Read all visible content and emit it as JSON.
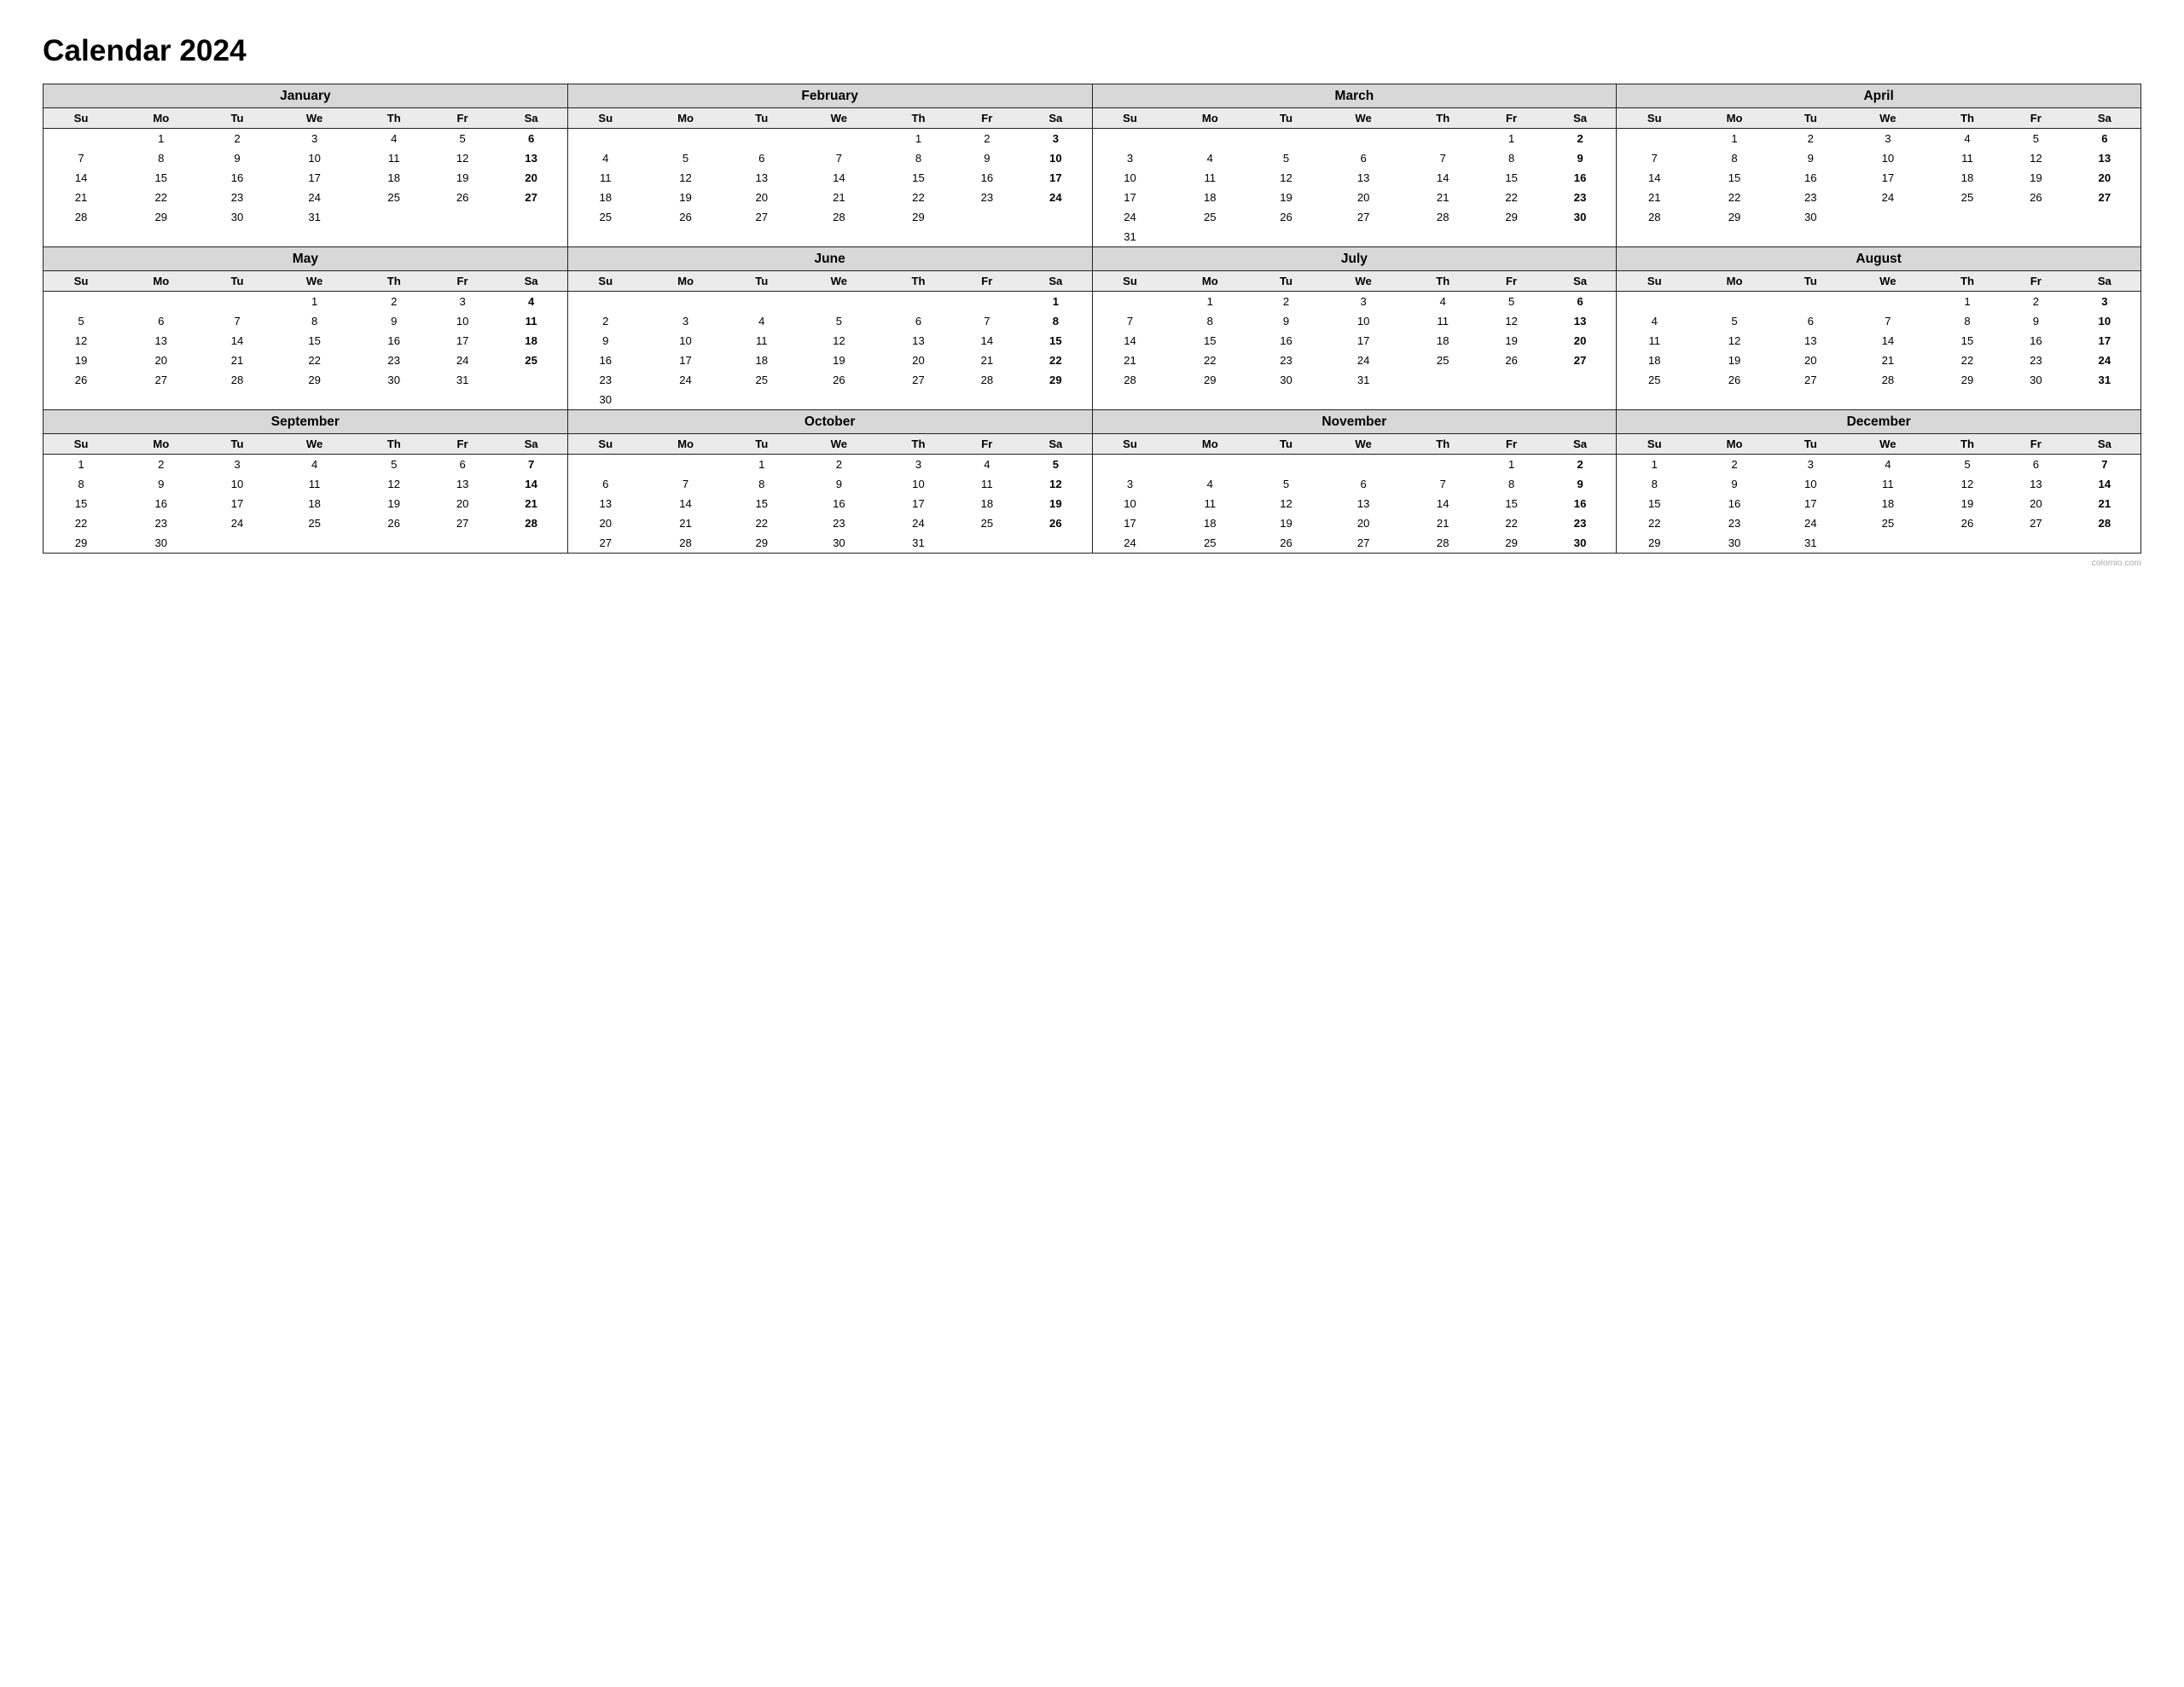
{
  "title": "Calendar 2024",
  "watermark": "colomio.com",
  "days_header": [
    "Su",
    "Mo",
    "Tu",
    "We",
    "Th",
    "Fr",
    "Sa"
  ],
  "months": [
    {
      "name": "January",
      "weeks": [
        [
          "",
          "1",
          "2",
          "3",
          "4",
          "5",
          "6"
        ],
        [
          "7",
          "8",
          "9",
          "10",
          "11",
          "12",
          "13"
        ],
        [
          "14",
          "15",
          "16",
          "17",
          "18",
          "19",
          "20"
        ],
        [
          "21",
          "22",
          "23",
          "24",
          "25",
          "26",
          "27"
        ],
        [
          "28",
          "29",
          "30",
          "31",
          "",
          "",
          ""
        ]
      ]
    },
    {
      "name": "February",
      "weeks": [
        [
          "",
          "",
          "",
          "",
          "1",
          "2",
          "3"
        ],
        [
          "4",
          "5",
          "6",
          "7",
          "8",
          "9",
          "10"
        ],
        [
          "11",
          "12",
          "13",
          "14",
          "15",
          "16",
          "17"
        ],
        [
          "18",
          "19",
          "20",
          "21",
          "22",
          "23",
          "24"
        ],
        [
          "25",
          "26",
          "27",
          "28",
          "29",
          "",
          ""
        ]
      ]
    },
    {
      "name": "March",
      "weeks": [
        [
          "",
          "",
          "",
          "",
          "",
          "1",
          "2"
        ],
        [
          "3",
          "4",
          "5",
          "6",
          "7",
          "8",
          "9"
        ],
        [
          "10",
          "11",
          "12",
          "13",
          "14",
          "15",
          "16"
        ],
        [
          "17",
          "18",
          "19",
          "20",
          "21",
          "22",
          "23"
        ],
        [
          "24",
          "25",
          "26",
          "27",
          "28",
          "29",
          "30"
        ],
        [
          "31",
          "",
          "",
          "",
          "",
          "",
          ""
        ]
      ]
    },
    {
      "name": "April",
      "weeks": [
        [
          "",
          "1",
          "2",
          "3",
          "4",
          "5",
          "6"
        ],
        [
          "7",
          "8",
          "9",
          "10",
          "11",
          "12",
          "13"
        ],
        [
          "14",
          "15",
          "16",
          "17",
          "18",
          "19",
          "20"
        ],
        [
          "21",
          "22",
          "23",
          "24",
          "25",
          "26",
          "27"
        ],
        [
          "28",
          "29",
          "30",
          "",
          "",
          "",
          ""
        ]
      ]
    },
    {
      "name": "May",
      "weeks": [
        [
          "",
          "",
          "",
          "1",
          "2",
          "3",
          "4"
        ],
        [
          "5",
          "6",
          "7",
          "8",
          "9",
          "10",
          "11"
        ],
        [
          "12",
          "13",
          "14",
          "15",
          "16",
          "17",
          "18"
        ],
        [
          "19",
          "20",
          "21",
          "22",
          "23",
          "24",
          "25"
        ],
        [
          "26",
          "27",
          "28",
          "29",
          "30",
          "31",
          ""
        ]
      ]
    },
    {
      "name": "June",
      "weeks": [
        [
          "",
          "",
          "",
          "",
          "",
          "",
          "1"
        ],
        [
          "2",
          "3",
          "4",
          "5",
          "6",
          "7",
          "8"
        ],
        [
          "9",
          "10",
          "11",
          "12",
          "13",
          "14",
          "15"
        ],
        [
          "16",
          "17",
          "18",
          "19",
          "20",
          "21",
          "22"
        ],
        [
          "23",
          "24",
          "25",
          "26",
          "27",
          "28",
          "29"
        ],
        [
          "30",
          "",
          "",
          "",
          "",
          "",
          ""
        ]
      ]
    },
    {
      "name": "July",
      "weeks": [
        [
          "",
          "1",
          "2",
          "3",
          "4",
          "5",
          "6"
        ],
        [
          "7",
          "8",
          "9",
          "10",
          "11",
          "12",
          "13"
        ],
        [
          "14",
          "15",
          "16",
          "17",
          "18",
          "19",
          "20"
        ],
        [
          "21",
          "22",
          "23",
          "24",
          "25",
          "26",
          "27"
        ],
        [
          "28",
          "29",
          "30",
          "31",
          "",
          "",
          ""
        ]
      ]
    },
    {
      "name": "August",
      "weeks": [
        [
          "",
          "",
          "",
          "",
          "1",
          "2",
          "3"
        ],
        [
          "4",
          "5",
          "6",
          "7",
          "8",
          "9",
          "10"
        ],
        [
          "11",
          "12",
          "13",
          "14",
          "15",
          "16",
          "17"
        ],
        [
          "18",
          "19",
          "20",
          "21",
          "22",
          "23",
          "24"
        ],
        [
          "25",
          "26",
          "27",
          "28",
          "29",
          "30",
          "31"
        ]
      ]
    },
    {
      "name": "September",
      "weeks": [
        [
          "1",
          "2",
          "3",
          "4",
          "5",
          "6",
          "7"
        ],
        [
          "8",
          "9",
          "10",
          "11",
          "12",
          "13",
          "14"
        ],
        [
          "15",
          "16",
          "17",
          "18",
          "19",
          "20",
          "21"
        ],
        [
          "22",
          "23",
          "24",
          "25",
          "26",
          "27",
          "28"
        ],
        [
          "29",
          "30",
          "",
          "",
          "",
          "",
          ""
        ]
      ]
    },
    {
      "name": "October",
      "weeks": [
        [
          "",
          "",
          "1",
          "2",
          "3",
          "4",
          "5"
        ],
        [
          "6",
          "7",
          "8",
          "9",
          "10",
          "11",
          "12"
        ],
        [
          "13",
          "14",
          "15",
          "16",
          "17",
          "18",
          "19"
        ],
        [
          "20",
          "21",
          "22",
          "23",
          "24",
          "25",
          "26"
        ],
        [
          "27",
          "28",
          "29",
          "30",
          "31",
          "",
          ""
        ]
      ]
    },
    {
      "name": "November",
      "weeks": [
        [
          "",
          "",
          "",
          "",
          "",
          "1",
          "2"
        ],
        [
          "3",
          "4",
          "5",
          "6",
          "7",
          "8",
          "9"
        ],
        [
          "10",
          "11",
          "12",
          "13",
          "14",
          "15",
          "16"
        ],
        [
          "17",
          "18",
          "19",
          "20",
          "21",
          "22",
          "23"
        ],
        [
          "24",
          "25",
          "26",
          "27",
          "28",
          "29",
          "30"
        ]
      ]
    },
    {
      "name": "December",
      "weeks": [
        [
          "1",
          "2",
          "3",
          "4",
          "5",
          "6",
          "7"
        ],
        [
          "8",
          "9",
          "10",
          "11",
          "12",
          "13",
          "14"
        ],
        [
          "15",
          "16",
          "17",
          "18",
          "19",
          "20",
          "21"
        ],
        [
          "22",
          "23",
          "24",
          "25",
          "26",
          "27",
          "28"
        ],
        [
          "29",
          "30",
          "31",
          "",
          "",
          "",
          ""
        ]
      ]
    }
  ]
}
